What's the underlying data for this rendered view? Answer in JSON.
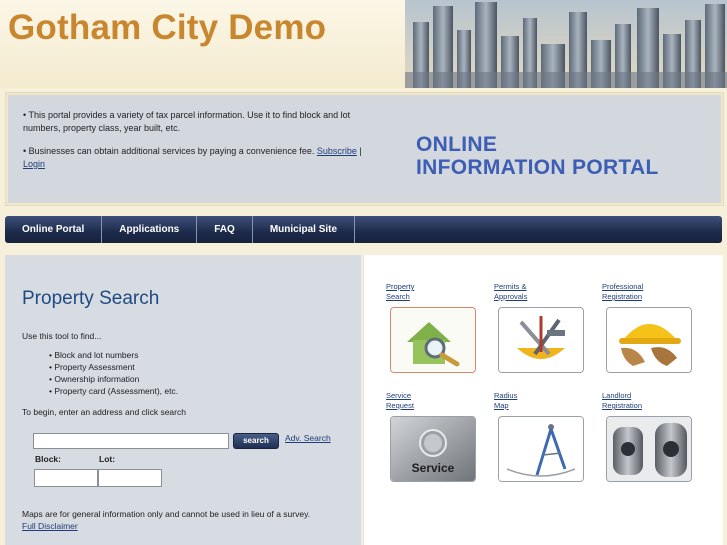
{
  "header": {
    "site_title": "Gotham City Demo"
  },
  "info": {
    "bullet1": "• This portal provides a variety of tax parcel information. Use it to find block and lot numbers, property class, year built, etc.",
    "bullet2_prefix": "• Businesses can obtain additional services by paying a convenience fee. ",
    "subscribe_link": "Subscribe",
    "separator": " | ",
    "login_link": "Login",
    "portal_line1": "ONLINE",
    "portal_line2": "INFORMATION PORTAL"
  },
  "nav": {
    "items": [
      "Online Portal",
      "Applications",
      "FAQ",
      "Municipal Site"
    ]
  },
  "property_search": {
    "title": "Property Search",
    "intro": "Use this tool to find...",
    "list": [
      "Block and lot numbers",
      "Property Assessment",
      "Ownership information",
      "Property card (Assessment), etc."
    ],
    "begin_text": "To begin, enter an address and click search",
    "search_button": "search",
    "adv_search_link": "Adv. Search",
    "block_label": "Block:",
    "lot_label": "Lot:",
    "address_value": "",
    "block_value": "",
    "lot_value": "",
    "disclaimer_text": "Maps are for general information only and cannot be used in lieu of a survey.",
    "disclaimer_link": "Full Disclaimer"
  },
  "tiles": [
    {
      "line1": "Property",
      "line2": "Search"
    },
    {
      "line1": "Permits &",
      "line2": "Approvals"
    },
    {
      "line1": "Professional",
      "line2": "Registration"
    },
    {
      "line1": "Service",
      "line2": "Request"
    },
    {
      "line1": "Radius",
      "line2": "Map"
    },
    {
      "line1": "Landlord",
      "line2": "Registration"
    }
  ],
  "service_tile_text": "Service",
  "icons": {
    "tile1": "house-magnifier-icon",
    "tile2": "tools-helmet-icon",
    "tile3": "hardhat-gloves-icon",
    "tile4": "service-button-icon",
    "tile5": "compass-icon",
    "tile6": "security-camera-icon"
  },
  "colors": {
    "title_orange": "#c8862e",
    "portal_blue": "#3c5eb4",
    "nav_dark": "#1d2a4a",
    "heading_blue": "#1f4a82"
  }
}
